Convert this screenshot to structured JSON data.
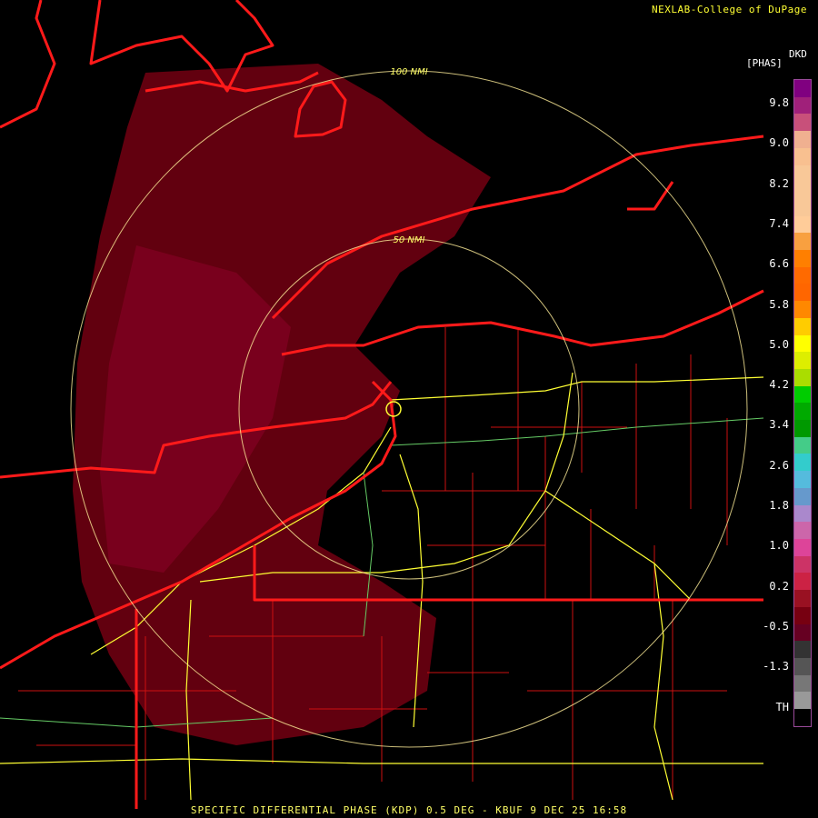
{
  "credit": "NEXLAB-College of DuPage",
  "footer": "SPECIFIC DIFFERENTIAL PHASE (KDP) 0.5 DEG - KBUF 9 DEC 25 16:58",
  "legend": {
    "title": "DKD",
    "unit": "[PHAS]",
    "ticks": [
      "9.8",
      "9.0",
      "8.2",
      "7.4",
      "6.6",
      "5.8",
      "5.0",
      "4.2",
      "3.4",
      "2.6",
      "1.8",
      "1.0",
      "0.2",
      "-0.5",
      "-1.3",
      "TH"
    ],
    "colors": [
      "#800080",
      "#a0207a",
      "#c8507a",
      "#f0b090",
      "#f8c090",
      "#f8c898",
      "#f8c898",
      "#f8c898",
      "#ffcc99",
      "#f8a040",
      "#ff7f00",
      "#ff6a00",
      "#ff6600",
      "#ff8800",
      "#ffcc00",
      "#ffff00",
      "#ddee00",
      "#aadd00",
      "#00cc00",
      "#00aa00",
      "#009900",
      "#44cc88",
      "#33cccc",
      "#55bbdd",
      "#6699cc",
      "#aa88cc",
      "#cc66aa",
      "#dd4499",
      "#cc3366",
      "#cc2244",
      "#991122",
      "#770011",
      "#660022",
      "#333333",
      "#555555",
      "#777777",
      "#999999",
      "#000000"
    ]
  },
  "range_rings": {
    "inner_label": "50 NMI",
    "outer_label": "100 NMI"
  }
}
